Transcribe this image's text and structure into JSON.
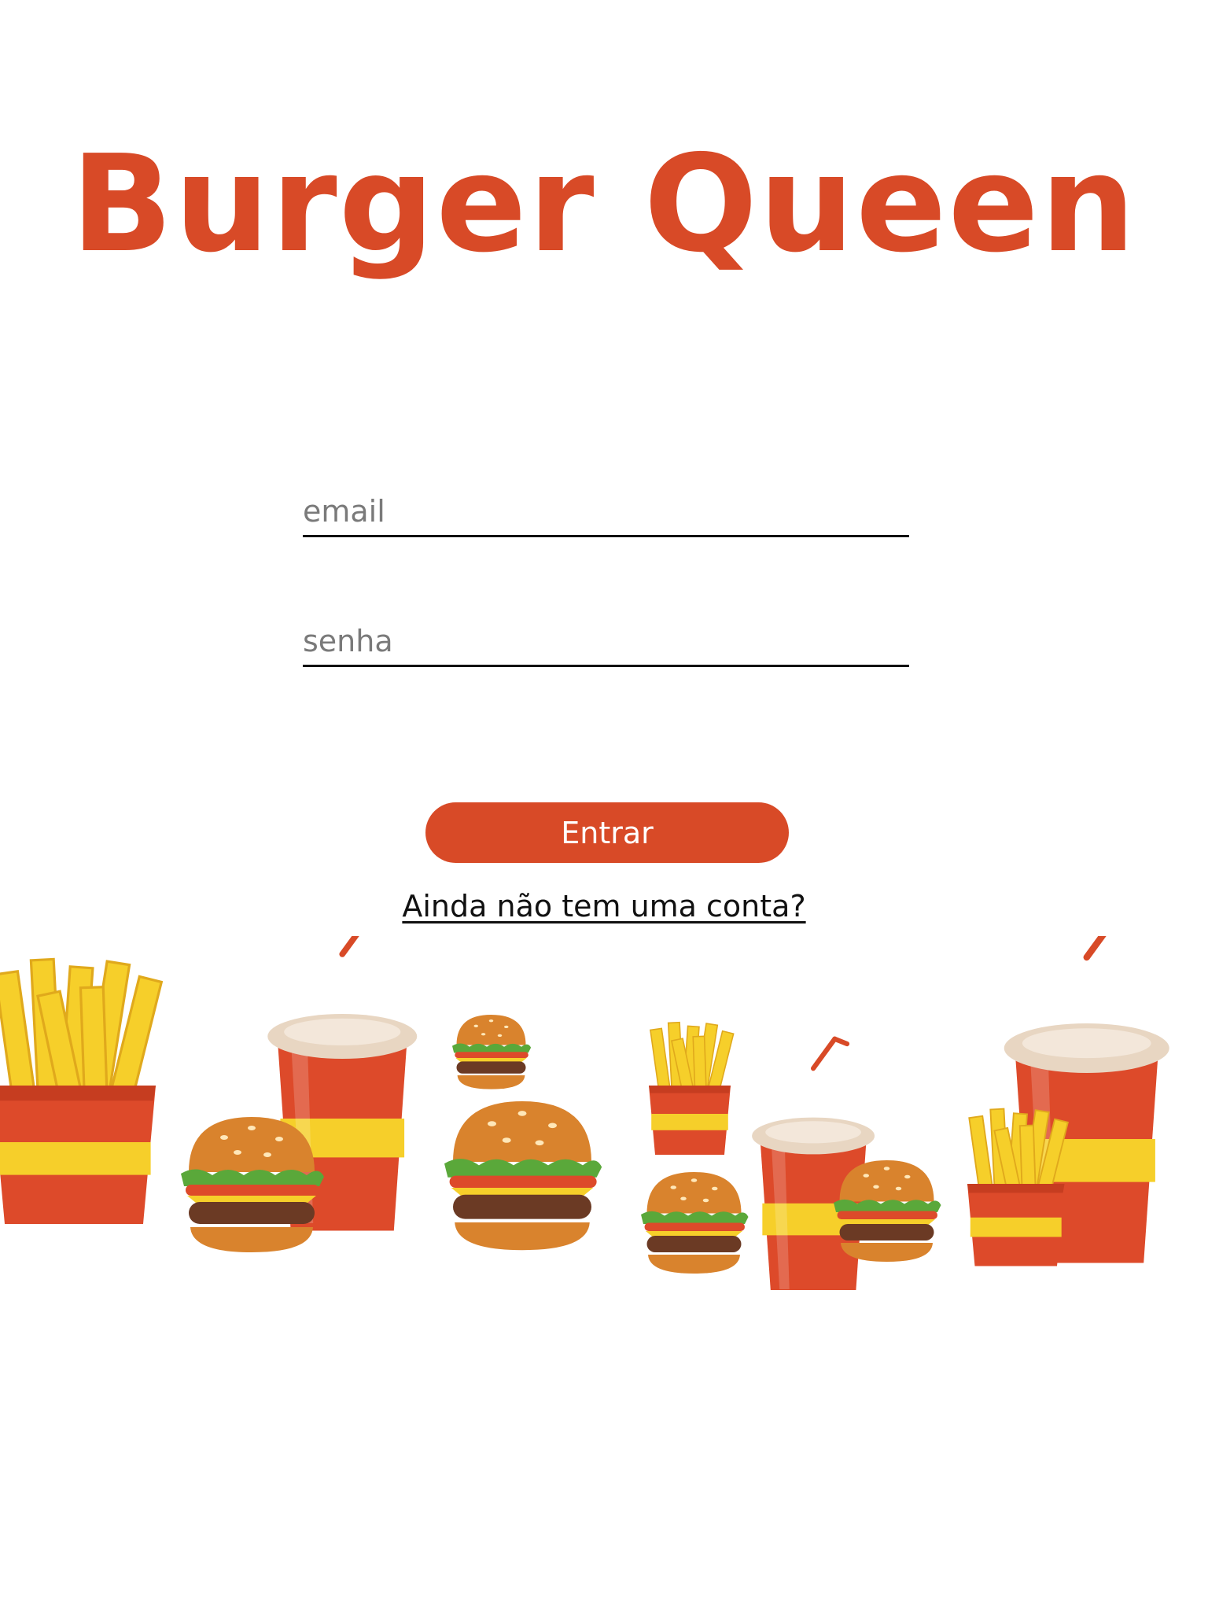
{
  "app": {
    "title": "Burger Queen"
  },
  "login_form": {
    "email_placeholder": "email",
    "password_placeholder": "senha",
    "submit_label": "Entrar",
    "signup_link": "Ainda não tem uma conta?"
  },
  "colors": {
    "brand": "#d84a27",
    "ketchup_red": "#dd4a2a",
    "mustard_yellow": "#f6cf2a",
    "bun_orange": "#d9832d",
    "lettuce_green": "#5aa83a",
    "text": "#111111",
    "placeholder": "#7a7a7a",
    "background": "#ffffff"
  },
  "illustration": {
    "icons": [
      "fries-icon",
      "soda-cup-icon",
      "burger-icon"
    ]
  }
}
